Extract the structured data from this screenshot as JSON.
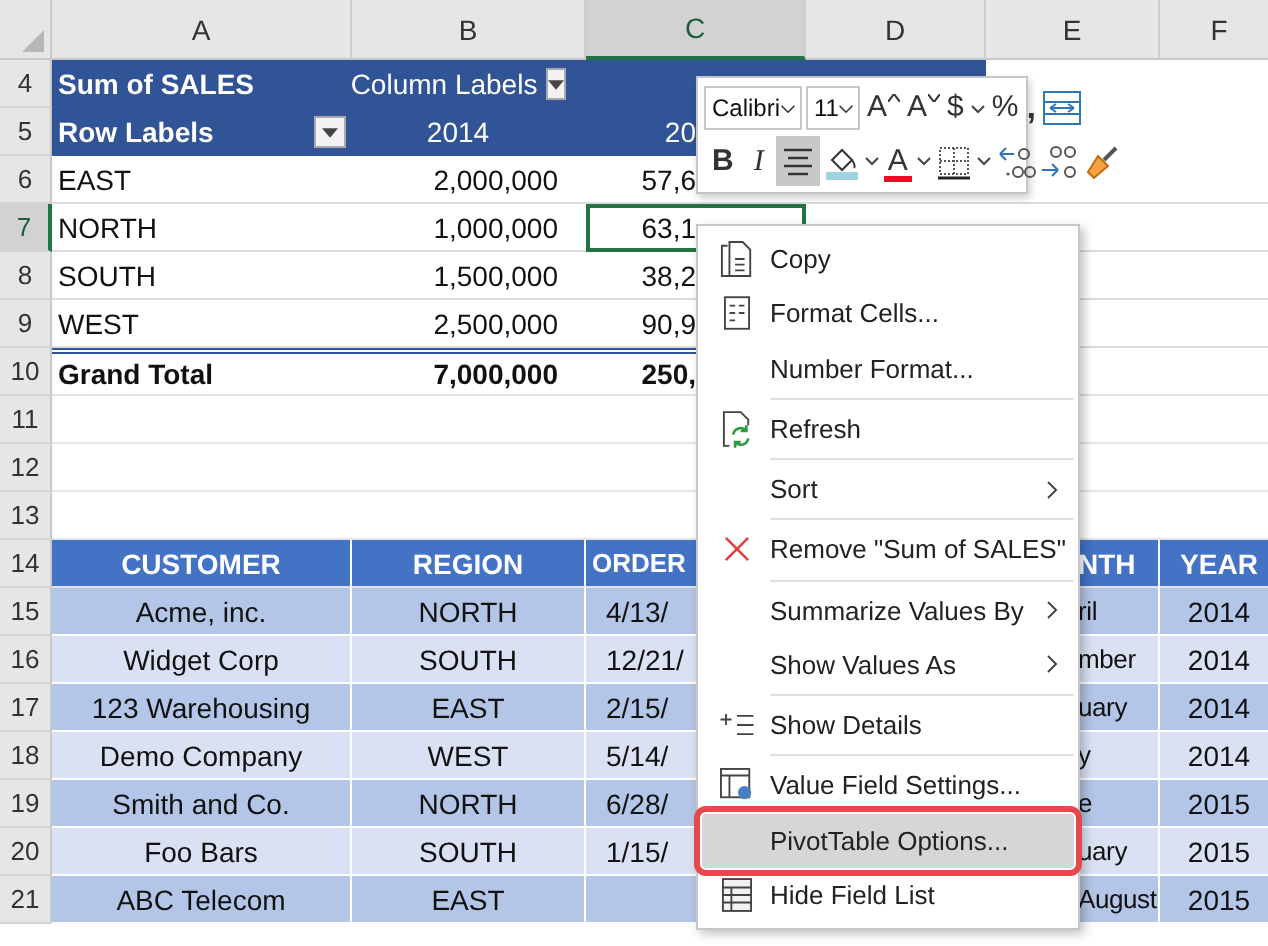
{
  "columns": [
    {
      "label": "A",
      "selected": false
    },
    {
      "label": "B",
      "selected": false
    },
    {
      "label": "C",
      "selected": true
    },
    {
      "label": "D",
      "selected": false
    },
    {
      "label": "E",
      "selected": false
    },
    {
      "label": "F",
      "selected": false
    }
  ],
  "rows": [
    {
      "number": "4",
      "selected": false,
      "kind": "pivot-header",
      "cells": [
        "Sum of SALES",
        {
          "text": "Column Labels",
          "dropdown": true
        },
        null,
        null,
        null,
        null
      ]
    },
    {
      "number": "5",
      "selected": false,
      "kind": "pivot-header",
      "cells": [
        {
          "text": "Row Labels",
          "dropdown": true
        },
        "2014",
        "20",
        null,
        null,
        null
      ]
    },
    {
      "number": "6",
      "selected": false,
      "kind": "pivot-row",
      "cells": [
        "EAST",
        "2,000,000",
        "57,6",
        null,
        null,
        null
      ]
    },
    {
      "number": "7",
      "selected": true,
      "kind": "pivot-row",
      "cells": [
        "NORTH",
        "1,000,000",
        {
          "text": "63,1",
          "selected": true
        },
        null,
        null,
        null
      ]
    },
    {
      "number": "8",
      "selected": false,
      "kind": "pivot-row",
      "cells": [
        "SOUTH",
        "1,500,000",
        "38,2",
        null,
        null,
        null
      ]
    },
    {
      "number": "9",
      "selected": false,
      "kind": "pivot-row",
      "cells": [
        "WEST",
        "2,500,000",
        "90,9",
        null,
        null,
        null
      ]
    },
    {
      "number": "10",
      "selected": false,
      "kind": "pivot-total",
      "cells": [
        "Grand Total",
        "7,000,000",
        "250,",
        null,
        null,
        null
      ]
    },
    {
      "number": "11",
      "selected": false,
      "kind": "empty",
      "cells": [
        null,
        null,
        null,
        null,
        null,
        null
      ]
    },
    {
      "number": "12",
      "selected": false,
      "kind": "empty",
      "cells": [
        null,
        null,
        null,
        null,
        null,
        null
      ]
    },
    {
      "number": "13",
      "selected": false,
      "kind": "empty",
      "cells": [
        null,
        null,
        null,
        null,
        null,
        null
      ]
    },
    {
      "number": "14",
      "selected": false,
      "kind": "table-header",
      "cells": [
        "CUSTOMER",
        "REGION",
        "ORDER",
        null,
        "NTH",
        "YEAR"
      ]
    },
    {
      "number": "15",
      "selected": false,
      "kind": "table-dark",
      "cells": [
        "Acme, inc.",
        "NORTH",
        "4/13/",
        null,
        "ril",
        "2014"
      ]
    },
    {
      "number": "16",
      "selected": false,
      "kind": "table-light",
      "cells": [
        "Widget Corp",
        "SOUTH",
        "12/21/",
        null,
        "mber",
        "2014"
      ]
    },
    {
      "number": "17",
      "selected": false,
      "kind": "table-dark",
      "cells": [
        "123 Warehousing",
        "EAST",
        "2/15/",
        null,
        "uary",
        "2014"
      ]
    },
    {
      "number": "18",
      "selected": false,
      "kind": "table-light",
      "cells": [
        "Demo Company",
        "WEST",
        "5/14/",
        null,
        "y",
        "2014"
      ]
    },
    {
      "number": "19",
      "selected": false,
      "kind": "table-dark",
      "cells": [
        "Smith and Co.",
        "NORTH",
        "6/28/",
        null,
        "e",
        "2015"
      ]
    },
    {
      "number": "20",
      "selected": false,
      "kind": "table-light",
      "cells": [
        "Foo Bars",
        "SOUTH",
        "1/15/",
        null,
        "uary",
        "2015"
      ]
    },
    {
      "number": "21",
      "selected": false,
      "kind": "table-dark",
      "cells": [
        "ABC Telecom",
        "EAST",
        null,
        null,
        "August",
        "2015"
      ]
    }
  ],
  "mini_toolbar": {
    "font": "Calibri",
    "size": "11",
    "row_1": [
      {
        "kind": "grow",
        "label": "A"
      },
      {
        "kind": "shrink",
        "label": "A"
      },
      {
        "kind": "text",
        "label": "$"
      },
      {
        "kind": "caret"
      },
      {
        "kind": "text",
        "label": "%"
      },
      {
        "kind": "comma",
        "label": ","
      },
      {
        "kind": "wrap"
      }
    ],
    "row_2": [
      {
        "kind": "bold",
        "label": "B",
        "pressed": false
      },
      {
        "kind": "italic",
        "label": "I",
        "pressed": false
      },
      {
        "kind": "align",
        "pressed": true
      },
      {
        "kind": "fill"
      },
      {
        "kind": "caret"
      },
      {
        "kind": "font-color",
        "label": "A"
      },
      {
        "kind": "caret"
      },
      {
        "kind": "borders"
      },
      {
        "kind": "caret"
      },
      {
        "kind": "inc-decimal"
      },
      {
        "kind": "dec-decimal"
      },
      {
        "kind": "painter"
      }
    ]
  },
  "context_menu": [
    {
      "kind": "copy",
      "label": "Copy",
      "submenu": false,
      "selected": false
    },
    {
      "kind": "format",
      "label": "Format Cells...",
      "submenu": false,
      "selected": false
    },
    {
      "kind": "plain",
      "label": "Number Format...",
      "submenu": false,
      "selected": false
    },
    {
      "kind": "separator"
    },
    {
      "kind": "refresh",
      "label": "Refresh",
      "submenu": false,
      "selected": false
    },
    {
      "kind": "separator"
    },
    {
      "kind": "plain",
      "label": "Sort",
      "submenu": true,
      "selected": false
    },
    {
      "kind": "separator"
    },
    {
      "kind": "remove",
      "label": "Remove \"Sum of SALES\"",
      "submenu": false,
      "selected": false
    },
    {
      "kind": "separator"
    },
    {
      "kind": "plain",
      "label": "Summarize Values By",
      "submenu": true,
      "selected": false
    },
    {
      "kind": "plain",
      "label": "Show Values As",
      "submenu": true,
      "selected": false
    },
    {
      "kind": "separator"
    },
    {
      "kind": "details",
      "label": "Show Details",
      "submenu": false,
      "selected": false
    },
    {
      "kind": "separator"
    },
    {
      "kind": "settings",
      "label": "Value Field Settings...",
      "submenu": false,
      "selected": false
    },
    {
      "kind": "plain",
      "label": "PivotTable Options...",
      "submenu": false,
      "selected": true
    },
    {
      "kind": "fieldlist",
      "label": "Hide Field List",
      "submenu": false,
      "selected": false
    }
  ]
}
